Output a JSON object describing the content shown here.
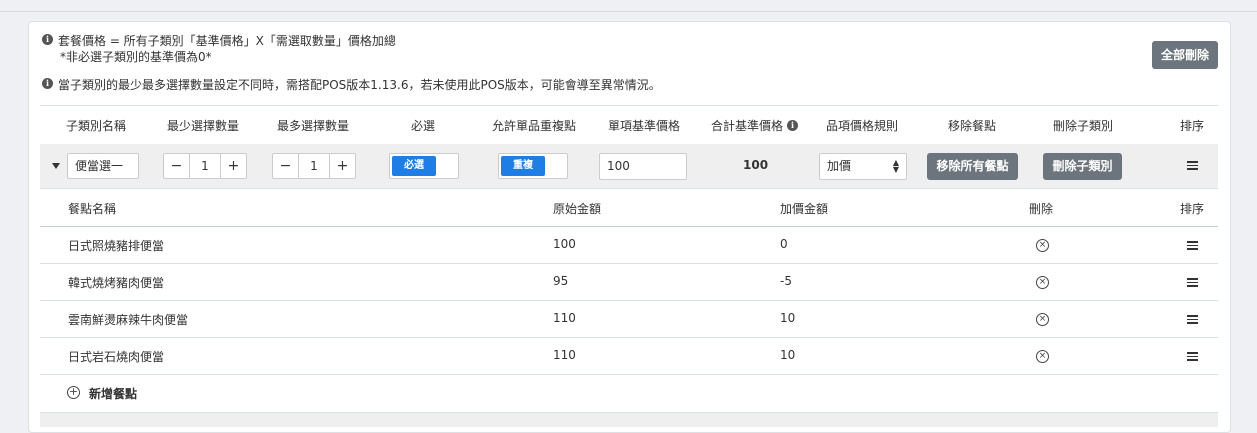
{
  "notes": {
    "line1": "套餐價格 = 所有子類別「基準價格」X「需選取數量」價格加總",
    "line1_sub": "*非必選子類別的基準價為0*",
    "line2": "當子類別的最少最多選擇數量設定不同時，需搭配POS版本1.13.6，若未使用此POS版本，可能會導至異常情況。"
  },
  "delete_all_label": "全部刪除",
  "headers": {
    "name": "子類別名稱",
    "min": "最少選擇數量",
    "max": "最多選擇數量",
    "required": "必選",
    "allow_dup": "允許單品重複點",
    "unit_price": "單項基準價格",
    "total_price": "合計基準價格",
    "price_rule": "品項價格規則",
    "remove_items": "移除餐點",
    "delete_cat": "刪除子類別",
    "sort": "排序"
  },
  "category": {
    "name": "便當選一",
    "min": "1",
    "max": "1",
    "required_label": "必選",
    "dup_label": "重複",
    "unit_price": "100",
    "total_price": "100",
    "price_rule": "加價",
    "remove_all_label": "移除所有餐點",
    "delete_cat_label": "刪除子類別",
    "minus": "−",
    "plus": "+"
  },
  "item_headers": {
    "name": "餐點名稱",
    "orig": "原始金額",
    "extra": "加價金額",
    "delete": "刪除",
    "sort": "排序"
  },
  "items": [
    {
      "name": "日式照燒豬排便當",
      "orig": "100",
      "extra": "0"
    },
    {
      "name": "韓式燒烤豬肉便當",
      "orig": "95",
      "extra": "-5"
    },
    {
      "name": "雲南鮮燙麻辣牛肉便當",
      "orig": "110",
      "extra": "10"
    },
    {
      "name": "日式岩石燒肉便當",
      "orig": "110",
      "extra": "10"
    }
  ],
  "add_item_label": "新增餐點",
  "icons": {
    "info": "info-icon",
    "delete": "circle-x-icon",
    "sort": "drag-handle-icon",
    "add": "circle-plus-icon",
    "expand": "caret-down-icon"
  },
  "colors": {
    "primary": "#1f7ee6",
    "dark_button": "#6c757d"
  }
}
